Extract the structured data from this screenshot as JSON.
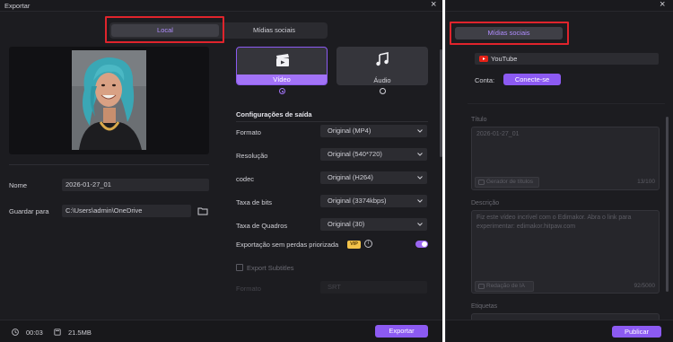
{
  "left": {
    "title": "Exportar",
    "tabs": {
      "local": "Local",
      "social": "Mídias sociais"
    },
    "fields": {
      "name_label": "Nome",
      "name_value": "2026-01-27_01",
      "save_label": "Guardar para",
      "save_value": "C:\\Users\\admin\\OneDrive"
    },
    "formats": {
      "video": "Vídeo",
      "audio": "Áudio"
    },
    "output": {
      "title": "Configurações de saída",
      "rows": [
        {
          "label": "Formato",
          "value": "Original (MP4)"
        },
        {
          "label": "Resolução",
          "value": "Original (540*720)"
        },
        {
          "label": "codec",
          "value": "Original (H264)"
        },
        {
          "label": "Taxa de bits",
          "value": "Original (3374kbps)"
        },
        {
          "label": "Taxa de Quadros",
          "value": "Original (30)"
        }
      ],
      "lossless_label": "Exportação sem perdas priorizada",
      "vip_badge": "VIP",
      "info_glyph": "i",
      "subtitles_label": "Export Subtitles",
      "sub_format_label": "Formato",
      "sub_format_value": "SRT"
    },
    "footer": {
      "duration": "00:03",
      "size": "21.5MB",
      "export_button": "Exportar"
    }
  },
  "right": {
    "tab": "Mídias sociais",
    "platform": "YouTube",
    "account_label": "Conta:",
    "connect_button": "Conecte-se",
    "title_label": "Título",
    "title_value": "2026-01-27_01",
    "title_generator": "Gerador de títulos",
    "title_count": "13/100",
    "description_label": "Descrição",
    "description_value": "Fiz este vídeo incrível com o Edimakor. Abra o link para experimentar: edimakor.hitpaw.com",
    "description_generator": "Redação de IA",
    "description_count": "92/5000",
    "tags_label": "Etiquetas",
    "publish_button": "Publicar"
  },
  "colors": {
    "accent": "#8c5af2",
    "accent_text": "#b08dff",
    "highlight_box": "#e0242c",
    "background": "#1c1c20",
    "vip": "#f3c34a"
  }
}
